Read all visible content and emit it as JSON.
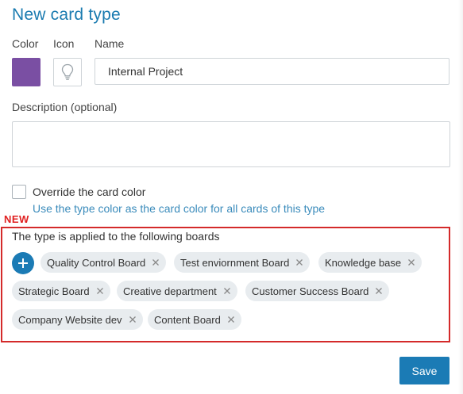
{
  "dialog": {
    "title": "New card type",
    "labels": {
      "color": "Color",
      "icon": "Icon",
      "name": "Name",
      "description": "Description (optional)"
    },
    "fields": {
      "name_value": "Internal Project",
      "description_value": ""
    },
    "swatch_color": "#7a4fa3",
    "icon": "lightbulb-icon",
    "override": {
      "label": "Override the card color",
      "help": "Use the type color as the card color for all cards of this type",
      "checked": false
    },
    "new_badge": "NEW",
    "boards": {
      "label": "The type is applied to the following boards",
      "items": [
        "Quality Control Board",
        "Test enviornment Board",
        "Knowledge base",
        "Strategic Board",
        "Creative department",
        "Customer Success Board",
        "Company Website dev",
        "Content Board"
      ]
    },
    "save_label": "Save",
    "accent_color": "#1b7bb5",
    "highlight_color": "#d42a2a"
  }
}
